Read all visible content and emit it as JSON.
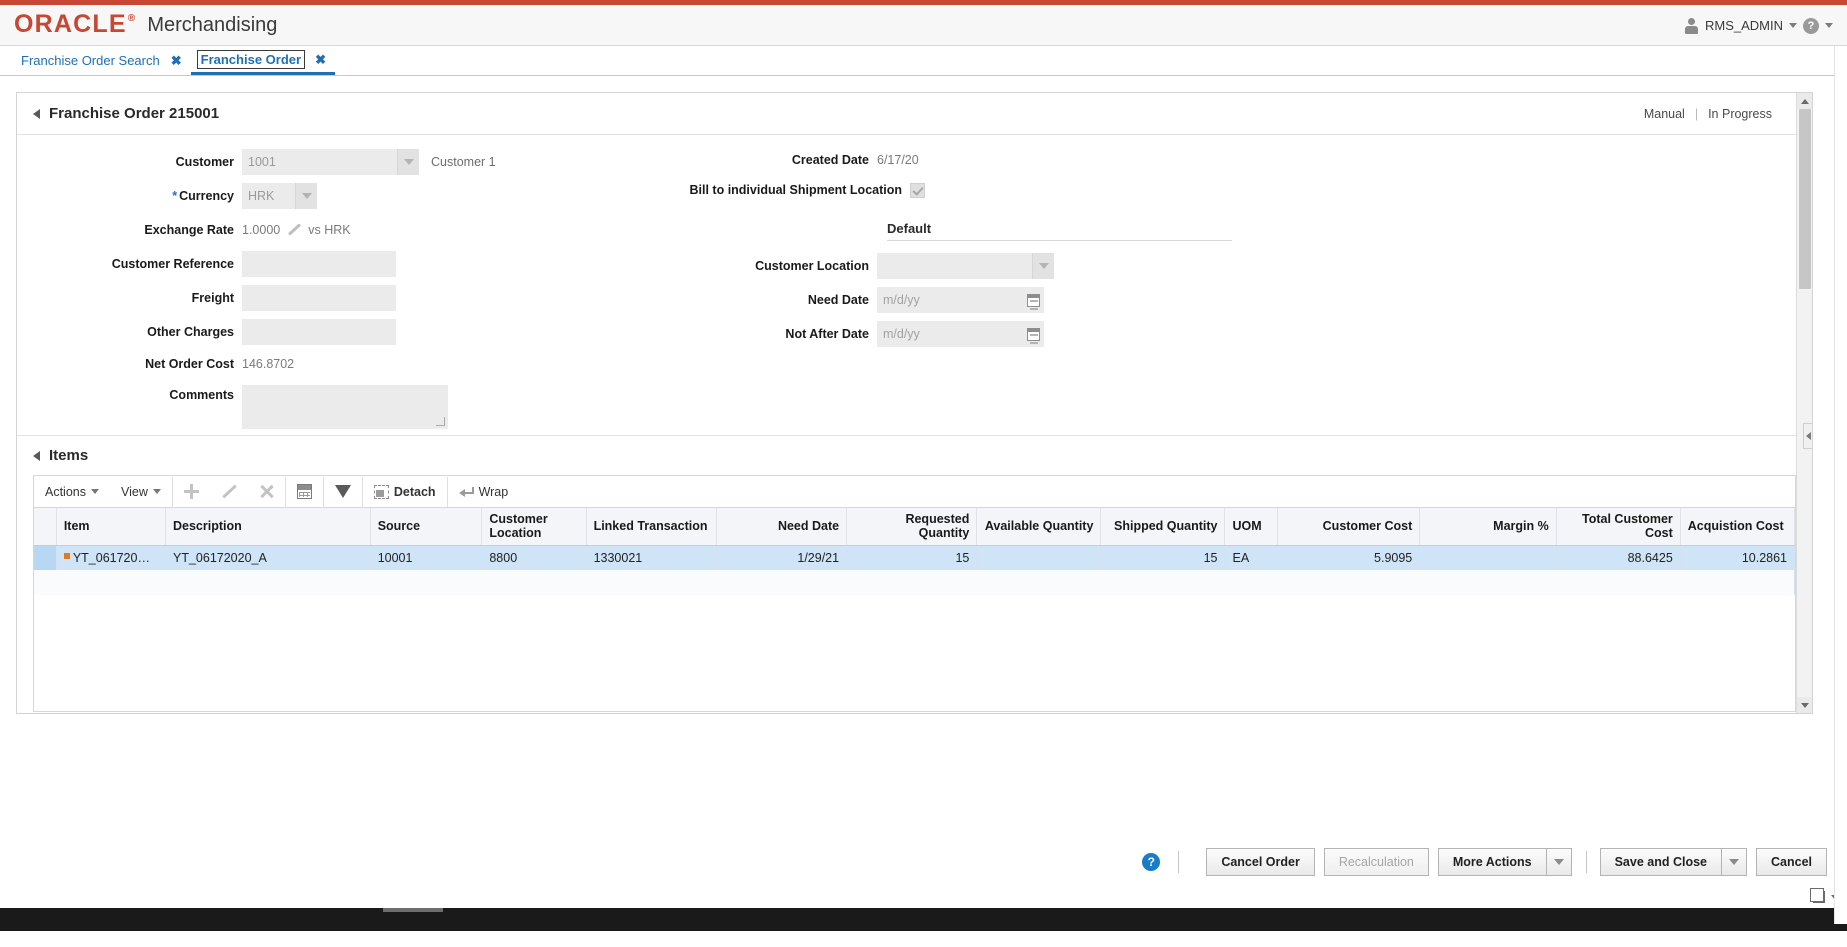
{
  "branding": {
    "logo": "ORACLE",
    "logo_tm": "®",
    "app_name": "Merchandising",
    "user": "RMS_ADMIN",
    "user_icon": "user-icon",
    "help_icon": "help-icon",
    "caret_icon": "chevron-down-icon"
  },
  "tabs": [
    {
      "label": "Franchise Order Search",
      "close": "✖",
      "active": false
    },
    {
      "label": "Franchise Order",
      "close": "✖",
      "active": true
    }
  ],
  "order_section": {
    "title": "Franchise Order 215001",
    "status_left": "Manual",
    "status_sep": "|",
    "status_right": "In Progress",
    "fields": {
      "customer_label": "Customer",
      "customer_value": "1001",
      "customer_name": "Customer 1",
      "currency_label": "Currency",
      "currency_required": "*",
      "currency_value": "HRK",
      "exchange_rate_label": "Exchange Rate",
      "exchange_rate_value": "1.0000",
      "exchange_rate_suffix": "vs HRK",
      "customer_reference_label": "Customer Reference",
      "customer_reference_value": "",
      "freight_label": "Freight",
      "freight_value": "",
      "other_charges_label": "Other Charges",
      "other_charges_value": "",
      "net_order_cost_label": "Net Order Cost",
      "net_order_cost_value": "146.8702",
      "comments_label": "Comments",
      "comments_value": "",
      "created_date_label": "Created Date",
      "created_date_value": "6/17/20",
      "bill_to_label": "Bill to individual Shipment Location",
      "bill_to_checked": true,
      "default_group_title": "Default",
      "customer_location_label": "Customer Location",
      "customer_location_value": "",
      "need_date_label": "Need Date",
      "need_date_placeholder": "m/d/yy",
      "not_after_date_label": "Not After Date",
      "not_after_date_placeholder": "m/d/yy"
    }
  },
  "items_section": {
    "title": "Items",
    "toolbar": {
      "actions_label": "Actions",
      "view_label": "View",
      "add_icon": "plus-icon",
      "edit_icon": "pencil-icon",
      "delete_icon": "close-x-icon",
      "export_icon": "export-xls-icon",
      "filter_icon": "filter-icon",
      "detach_label": "Detach",
      "detach_icon": "detach-icon",
      "wrap_label": "Wrap",
      "wrap_icon": "wrap-icon"
    },
    "columns": [
      {
        "label": "Item",
        "align": "left"
      },
      {
        "label": "Description",
        "align": "left"
      },
      {
        "label": "Source",
        "align": "left"
      },
      {
        "label": "Customer Location",
        "align": "left"
      },
      {
        "label": "Linked Transaction",
        "align": "left"
      },
      {
        "label": "Need Date",
        "align": "right"
      },
      {
        "label": "Requested Quantity",
        "align": "right"
      },
      {
        "label": "Available Quantity",
        "align": "right"
      },
      {
        "label": "Shipped Quantity",
        "align": "right"
      },
      {
        "label": "UOM",
        "align": "left"
      },
      {
        "label": "Customer Cost",
        "align": "right"
      },
      {
        "label": "Margin %",
        "align": "right"
      },
      {
        "label": "Total Customer Cost",
        "align": "right"
      },
      {
        "label": "Acquistion Cost",
        "align": "right"
      }
    ],
    "rows": [
      {
        "item": "YT_061720…",
        "description": "YT_06172020_A",
        "source": "10001",
        "customer_location": "8800",
        "linked_transaction": "1330021",
        "need_date": "1/29/21",
        "requested_quantity": "15",
        "available_quantity": "",
        "shipped_quantity": "15",
        "uom": "EA",
        "customer_cost": "5.9095",
        "margin_pct": "",
        "total_customer_cost": "88.6425",
        "acquisition_cost": "10.2861",
        "selected": true
      }
    ]
  },
  "footer": {
    "help_icon": "help-icon",
    "cancel_order_label": "Cancel Order",
    "recalculation_label": "Recalculation",
    "more_actions_label": "More Actions",
    "save_and_close_label": "Save and Close",
    "cancel_label": "Cancel"
  },
  "colors": {
    "brand_red": "#c74634",
    "link_blue": "#1f6fb5",
    "row_selected": "#cfe4f7",
    "header_bg": "#f3f5f8"
  }
}
